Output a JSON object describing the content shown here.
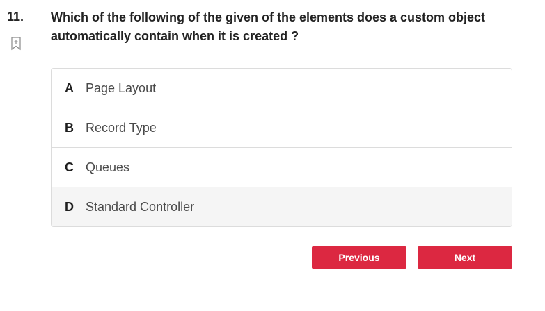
{
  "question": {
    "number": "11.",
    "text": "Which of the following of the given of the elements does a custom object automatically contain when it is created ?"
  },
  "bookmark": {
    "icon": "bookmark-add-icon"
  },
  "options": [
    {
      "letter": "A",
      "text": "Page Layout"
    },
    {
      "letter": "B",
      "text": "Record Type"
    },
    {
      "letter": "C",
      "text": "Queues"
    },
    {
      "letter": "D",
      "text": "Standard Controller"
    }
  ],
  "navigation": {
    "previous_label": "Previous",
    "next_label": "Next"
  },
  "colors": {
    "button": "#dc2841",
    "hover_row": "#f5f5f5",
    "border": "#dcdcdc"
  }
}
